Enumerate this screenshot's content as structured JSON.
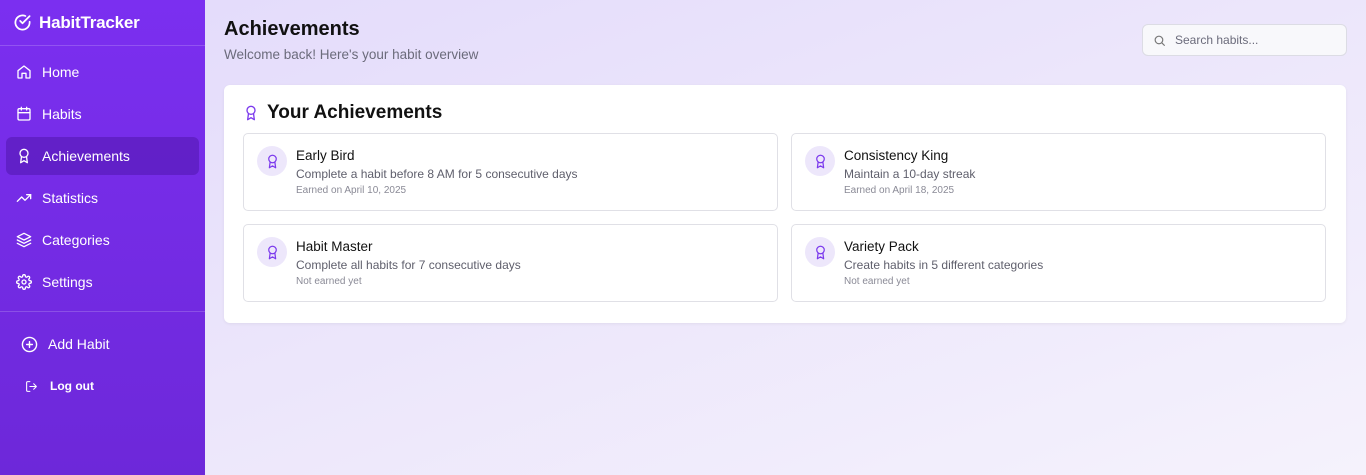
{
  "app": {
    "name": "HabitTracker"
  },
  "sidebar": {
    "items": [
      {
        "label": "Home",
        "icon": "home-icon",
        "active": false
      },
      {
        "label": "Habits",
        "icon": "calendar-icon",
        "active": false
      },
      {
        "label": "Achievements",
        "icon": "award-icon",
        "active": true
      },
      {
        "label": "Statistics",
        "icon": "trending-up-icon",
        "active": false
      },
      {
        "label": "Categories",
        "icon": "layers-icon",
        "active": false
      },
      {
        "label": "Settings",
        "icon": "gear-icon",
        "active": false
      }
    ],
    "add_habit_label": "Add Habit",
    "logout_label": "Log out"
  },
  "header": {
    "title": "Achievements",
    "subtitle": "Welcome back! Here's your habit overview"
  },
  "search": {
    "placeholder": "Search habits..."
  },
  "achievements": {
    "title": "Your Achievements",
    "items": [
      {
        "name": "Early Bird",
        "description": "Complete a habit before 8 AM for 5 consecutive days",
        "status": "Earned on April 10, 2025"
      },
      {
        "name": "Consistency King",
        "description": "Maintain a 10-day streak",
        "status": "Earned on April 18, 2025"
      },
      {
        "name": "Habit Master",
        "description": "Complete all habits for 7 consecutive days",
        "status": "Not earned yet"
      },
      {
        "name": "Variety Pack",
        "description": "Create habits in 5 different categories",
        "status": "Not earned yet"
      }
    ]
  },
  "colors": {
    "sidebar_bg": "#7b2ff0",
    "accent": "#7c3aed",
    "badge_bg": "#ede7fb"
  }
}
